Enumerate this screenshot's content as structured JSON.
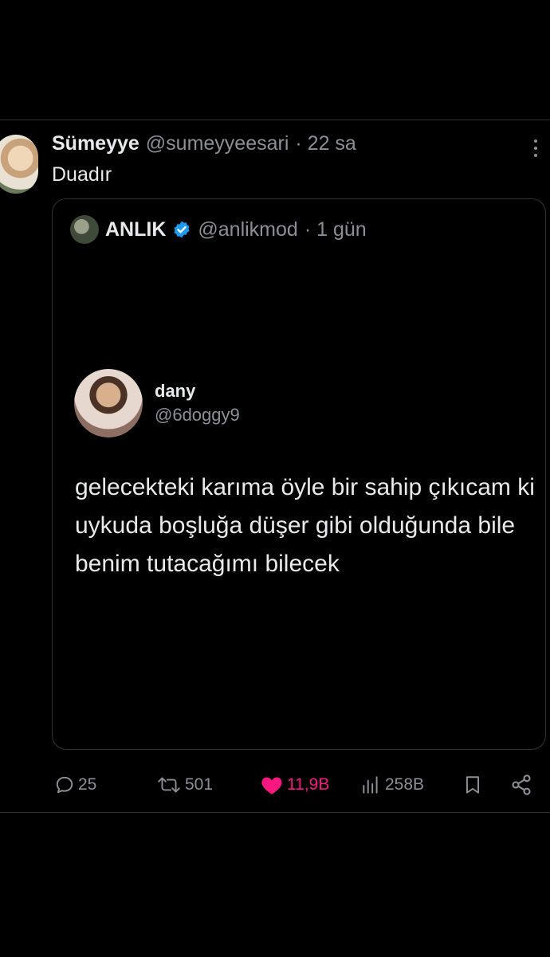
{
  "tweet": {
    "author_name": "Sümeyye",
    "author_handle": "@sumeyyeesari",
    "time": "· 22 sa",
    "text": "Duadır"
  },
  "quote": {
    "author_name": "ANLIK",
    "author_handle": "@anlikmod",
    "time": "· 1 gün",
    "inner": {
      "name": "dany",
      "handle": "@6doggy9",
      "text": "gelecekteki karıma öyle bir sahip çıkıcam ki uykuda boşluğa düşer gibi olduğunda bile benim tutacağımı bilecek"
    }
  },
  "actions": {
    "replies": "25",
    "retweets": "501",
    "likes": "11,9B",
    "views": "258B"
  },
  "colors": {
    "background": "#000000",
    "text": "#e7e9ea",
    "muted": "#8b9096",
    "like": "#f91880",
    "verified": "#1d9bf0",
    "border": "#2f3336"
  },
  "icons": [
    "more-icon",
    "verified-badge-icon",
    "reply-icon",
    "retweet-icon",
    "like-heart-icon",
    "views-icon",
    "bookmark-icon",
    "share-icon"
  ]
}
